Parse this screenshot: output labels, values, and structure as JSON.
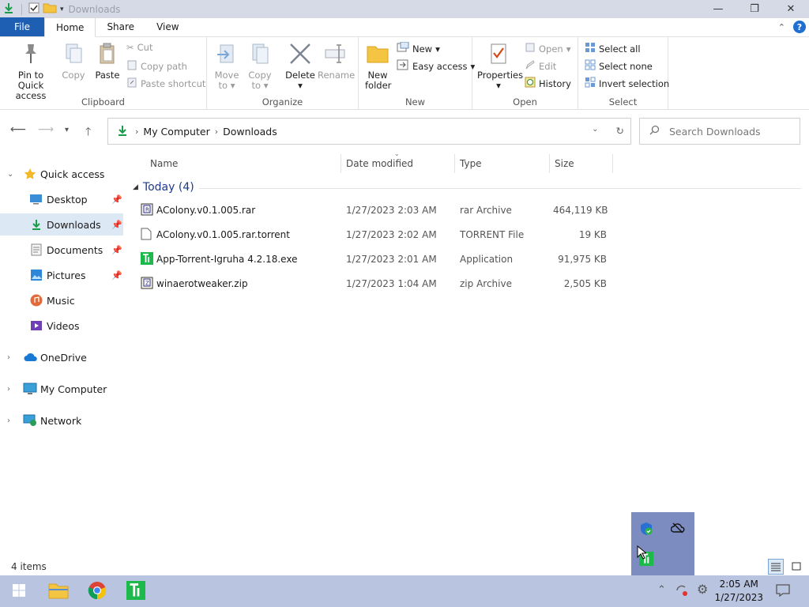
{
  "window": {
    "title": "Downloads",
    "minimize": "—",
    "maximize": "❐",
    "close": "✕"
  },
  "ribbon_tabs": [
    {
      "label": "File"
    },
    {
      "label": "Home"
    },
    {
      "label": "Share"
    },
    {
      "label": "View"
    }
  ],
  "ribbon": {
    "clipboard": {
      "label": "Clipboard",
      "pin": "Pin to Quick access",
      "pin_l1": "Pin to Quick",
      "pin_l2": "access",
      "copy": "Copy",
      "paste": "Paste",
      "cut": "Cut",
      "copy_path": "Copy path",
      "paste_shortcut": "Paste shortcut"
    },
    "organize": {
      "label": "Organize",
      "move_l1": "Move",
      "move_l2": "to",
      "copy_l1": "Copy",
      "copy_l2": "to",
      "delete": "Delete",
      "rename": "Rename"
    },
    "new": {
      "label": "New",
      "folder_l1": "New",
      "folder_l2": "folder",
      "new_item": "New",
      "easy_access": "Easy access"
    },
    "open": {
      "label": "Open",
      "properties": "Properties",
      "open": "Open",
      "edit": "Edit",
      "history": "History"
    },
    "select": {
      "label": "Select",
      "select_all": "Select all",
      "select_none": "Select none",
      "invert": "Invert selection"
    }
  },
  "address": {
    "crumbs": [
      "My Computer",
      "Downloads"
    ],
    "search_placeholder": "Search Downloads"
  },
  "sidebar": [
    {
      "label": "Quick access"
    },
    {
      "label": "Desktop"
    },
    {
      "label": "Downloads"
    },
    {
      "label": "Documents"
    },
    {
      "label": "Pictures"
    },
    {
      "label": "Music"
    },
    {
      "label": "Videos"
    },
    {
      "label": "OneDrive"
    },
    {
      "label": "My Computer"
    },
    {
      "label": "Network"
    }
  ],
  "columns": [
    {
      "label": "Name"
    },
    {
      "label": "Date modified"
    },
    {
      "label": "Type"
    },
    {
      "label": "Size"
    }
  ],
  "group": {
    "label": "Today (4)"
  },
  "files": [
    {
      "name": "AColony.v0.1.005.rar",
      "date": "1/27/2023 2:03 AM",
      "type": "rar Archive",
      "size": "464,119 KB"
    },
    {
      "name": "AColony.v0.1.005.rar.torrent",
      "date": "1/27/2023 2:02 AM",
      "type": "TORRENT File",
      "size": "19 KB"
    },
    {
      "name": "App-Torrent-Igruha 4.2.18.exe",
      "date": "1/27/2023 2:01 AM",
      "type": "Application",
      "size": "91,975 KB"
    },
    {
      "name": "winaerotweaker.zip",
      "date": "1/27/2023 1:04 AM",
      "type": "zip Archive",
      "size": "2,505 KB"
    }
  ],
  "status": {
    "items": "4 items"
  },
  "taskbar": {
    "time": "2:05 AM",
    "date": "1/27/2023"
  }
}
